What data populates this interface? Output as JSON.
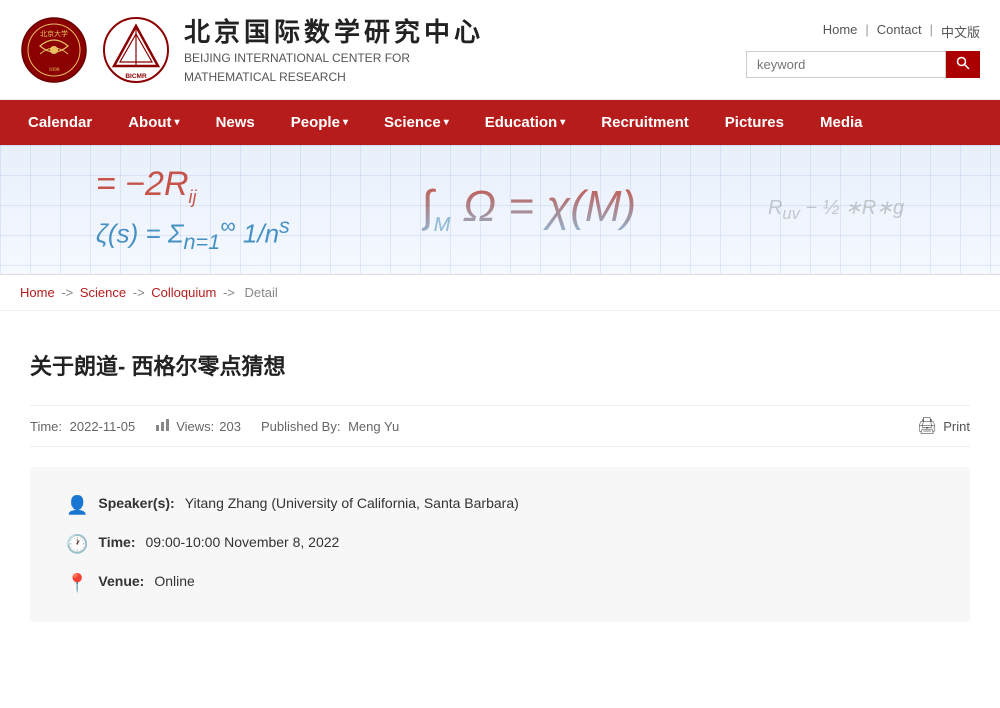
{
  "site": {
    "title_cn": "北京国际数学研究中心",
    "title_en_line1": "BEIJING INTERNATIONAL CENTER FOR",
    "title_en_line2": "MATHEMATICAL RESEARCH"
  },
  "top_links": {
    "home": "Home",
    "contact": "Contact",
    "chinese": "中文版"
  },
  "search": {
    "placeholder": "keyword",
    "button": "🔍"
  },
  "nav": {
    "items": [
      {
        "label": "Calendar",
        "has_arrow": false
      },
      {
        "label": "About",
        "has_arrow": true
      },
      {
        "label": "News",
        "has_arrow": false
      },
      {
        "label": "People",
        "has_arrow": true
      },
      {
        "label": "Science",
        "has_arrow": true
      },
      {
        "label": "Education",
        "has_arrow": true
      },
      {
        "label": "Recruitment",
        "has_arrow": false
      },
      {
        "label": "Pictures",
        "has_arrow": false
      },
      {
        "label": "Media",
        "has_arrow": false
      }
    ]
  },
  "breadcrumb": {
    "items": [
      "Home",
      "Science",
      "Colloquium"
    ],
    "current": "Detail"
  },
  "article": {
    "title": "关于朗道- 西格尔零点猜想",
    "time_label": "Time:",
    "time_value": "2022-11-05",
    "views_label": "Views:",
    "views_value": "203",
    "published_label": "Published By:",
    "published_value": "Meng Yu",
    "print_label": "Print"
  },
  "detail": {
    "speaker_label": "Speaker(s):",
    "speaker_value": "Yitang Zhang (University of California, Santa Barbara)",
    "time_label": "Time:",
    "time_value": "09:00-10:00 November 8, 2022",
    "venue_label": "Venue:",
    "venue_value": "Online"
  }
}
